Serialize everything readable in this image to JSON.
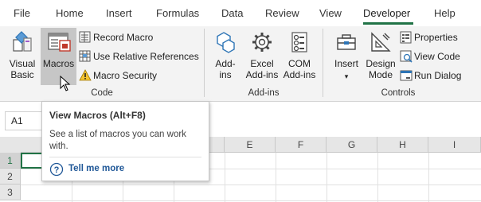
{
  "tabs": [
    {
      "label": "File"
    },
    {
      "label": "Home"
    },
    {
      "label": "Insert"
    },
    {
      "label": "Formulas"
    },
    {
      "label": "Data"
    },
    {
      "label": "Review"
    },
    {
      "label": "View"
    },
    {
      "label": "Developer"
    },
    {
      "label": "Help"
    }
  ],
  "active_tab": "Developer",
  "ribbon": {
    "code": {
      "label": "Code",
      "visual_basic": "Visual Basic",
      "macros": "Macros",
      "record_macro": "Record Macro",
      "use_relative_references": "Use Relative References",
      "macro_security": "Macro Security"
    },
    "addins": {
      "label": "Add-ins",
      "addins": "Add-ins",
      "excel_addins": "Excel Add-ins",
      "com_addins": "COM Add-ins"
    },
    "controls": {
      "label": "Controls",
      "insert": "Insert",
      "design_mode": "Design Mode",
      "properties": "Properties",
      "view_code": "View Code",
      "run_dialog": "Run Dialog"
    }
  },
  "name_box": "A1",
  "columns": [
    "E",
    "F",
    "G",
    "H",
    "I"
  ],
  "rows": [
    "1",
    "2",
    "3"
  ],
  "tooltip": {
    "title": "View Macros (Alt+F8)",
    "description": "See a list of macros you can work with.",
    "link": "Tell me more"
  },
  "colors": {
    "accent": "#217346",
    "link": "#1f5797",
    "ribbon_bg": "#f3f3f3"
  }
}
